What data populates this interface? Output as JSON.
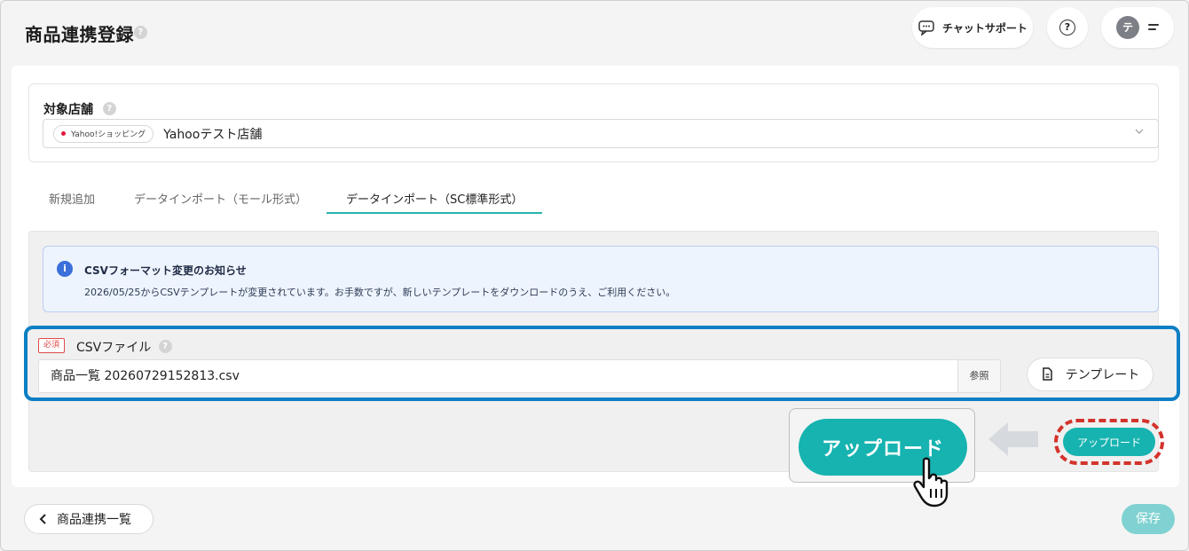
{
  "header": {
    "title": "商品連携登録",
    "help_icon": "?",
    "chat_support_label": "チャットサポート",
    "help_button_icon": "?",
    "user_avatar": "テ"
  },
  "store": {
    "label": "対象店舗",
    "help_icon": "?",
    "mall_badge": "Yahoo!ショッピング",
    "store_name": "Yahooテスト店舗"
  },
  "tabs": [
    {
      "label": "新規追加",
      "active": false
    },
    {
      "label": "データインポート（モール形式）",
      "active": false
    },
    {
      "label": "データインポート（SC標準形式）",
      "active": true
    }
  ],
  "notice": {
    "icon": "i",
    "title": "CSVフォーマット変更のお知らせ",
    "body": "2026/05/25からCSVテンプレートが変更されています。お手数ですが、新しいテンプレートをダウンロードのうえ、ご利用ください。"
  },
  "csv": {
    "required_badge": "必須",
    "label": "CSVファイル",
    "help_icon": "?",
    "file_value": "商品一覧 20260729152813.csv",
    "browse_label": "参照",
    "template_label": "テンプレート"
  },
  "upload": {
    "big_label": "アップロード",
    "small_label": "アップロード"
  },
  "footer": {
    "back_label": "商品連携一覧",
    "save_label": "保存"
  },
  "colors": {
    "accent": "#16b3b0",
    "highlight_border": "#0d7fc4",
    "dashed_highlight": "#d3332b",
    "info_blue": "#3b6fd9"
  }
}
